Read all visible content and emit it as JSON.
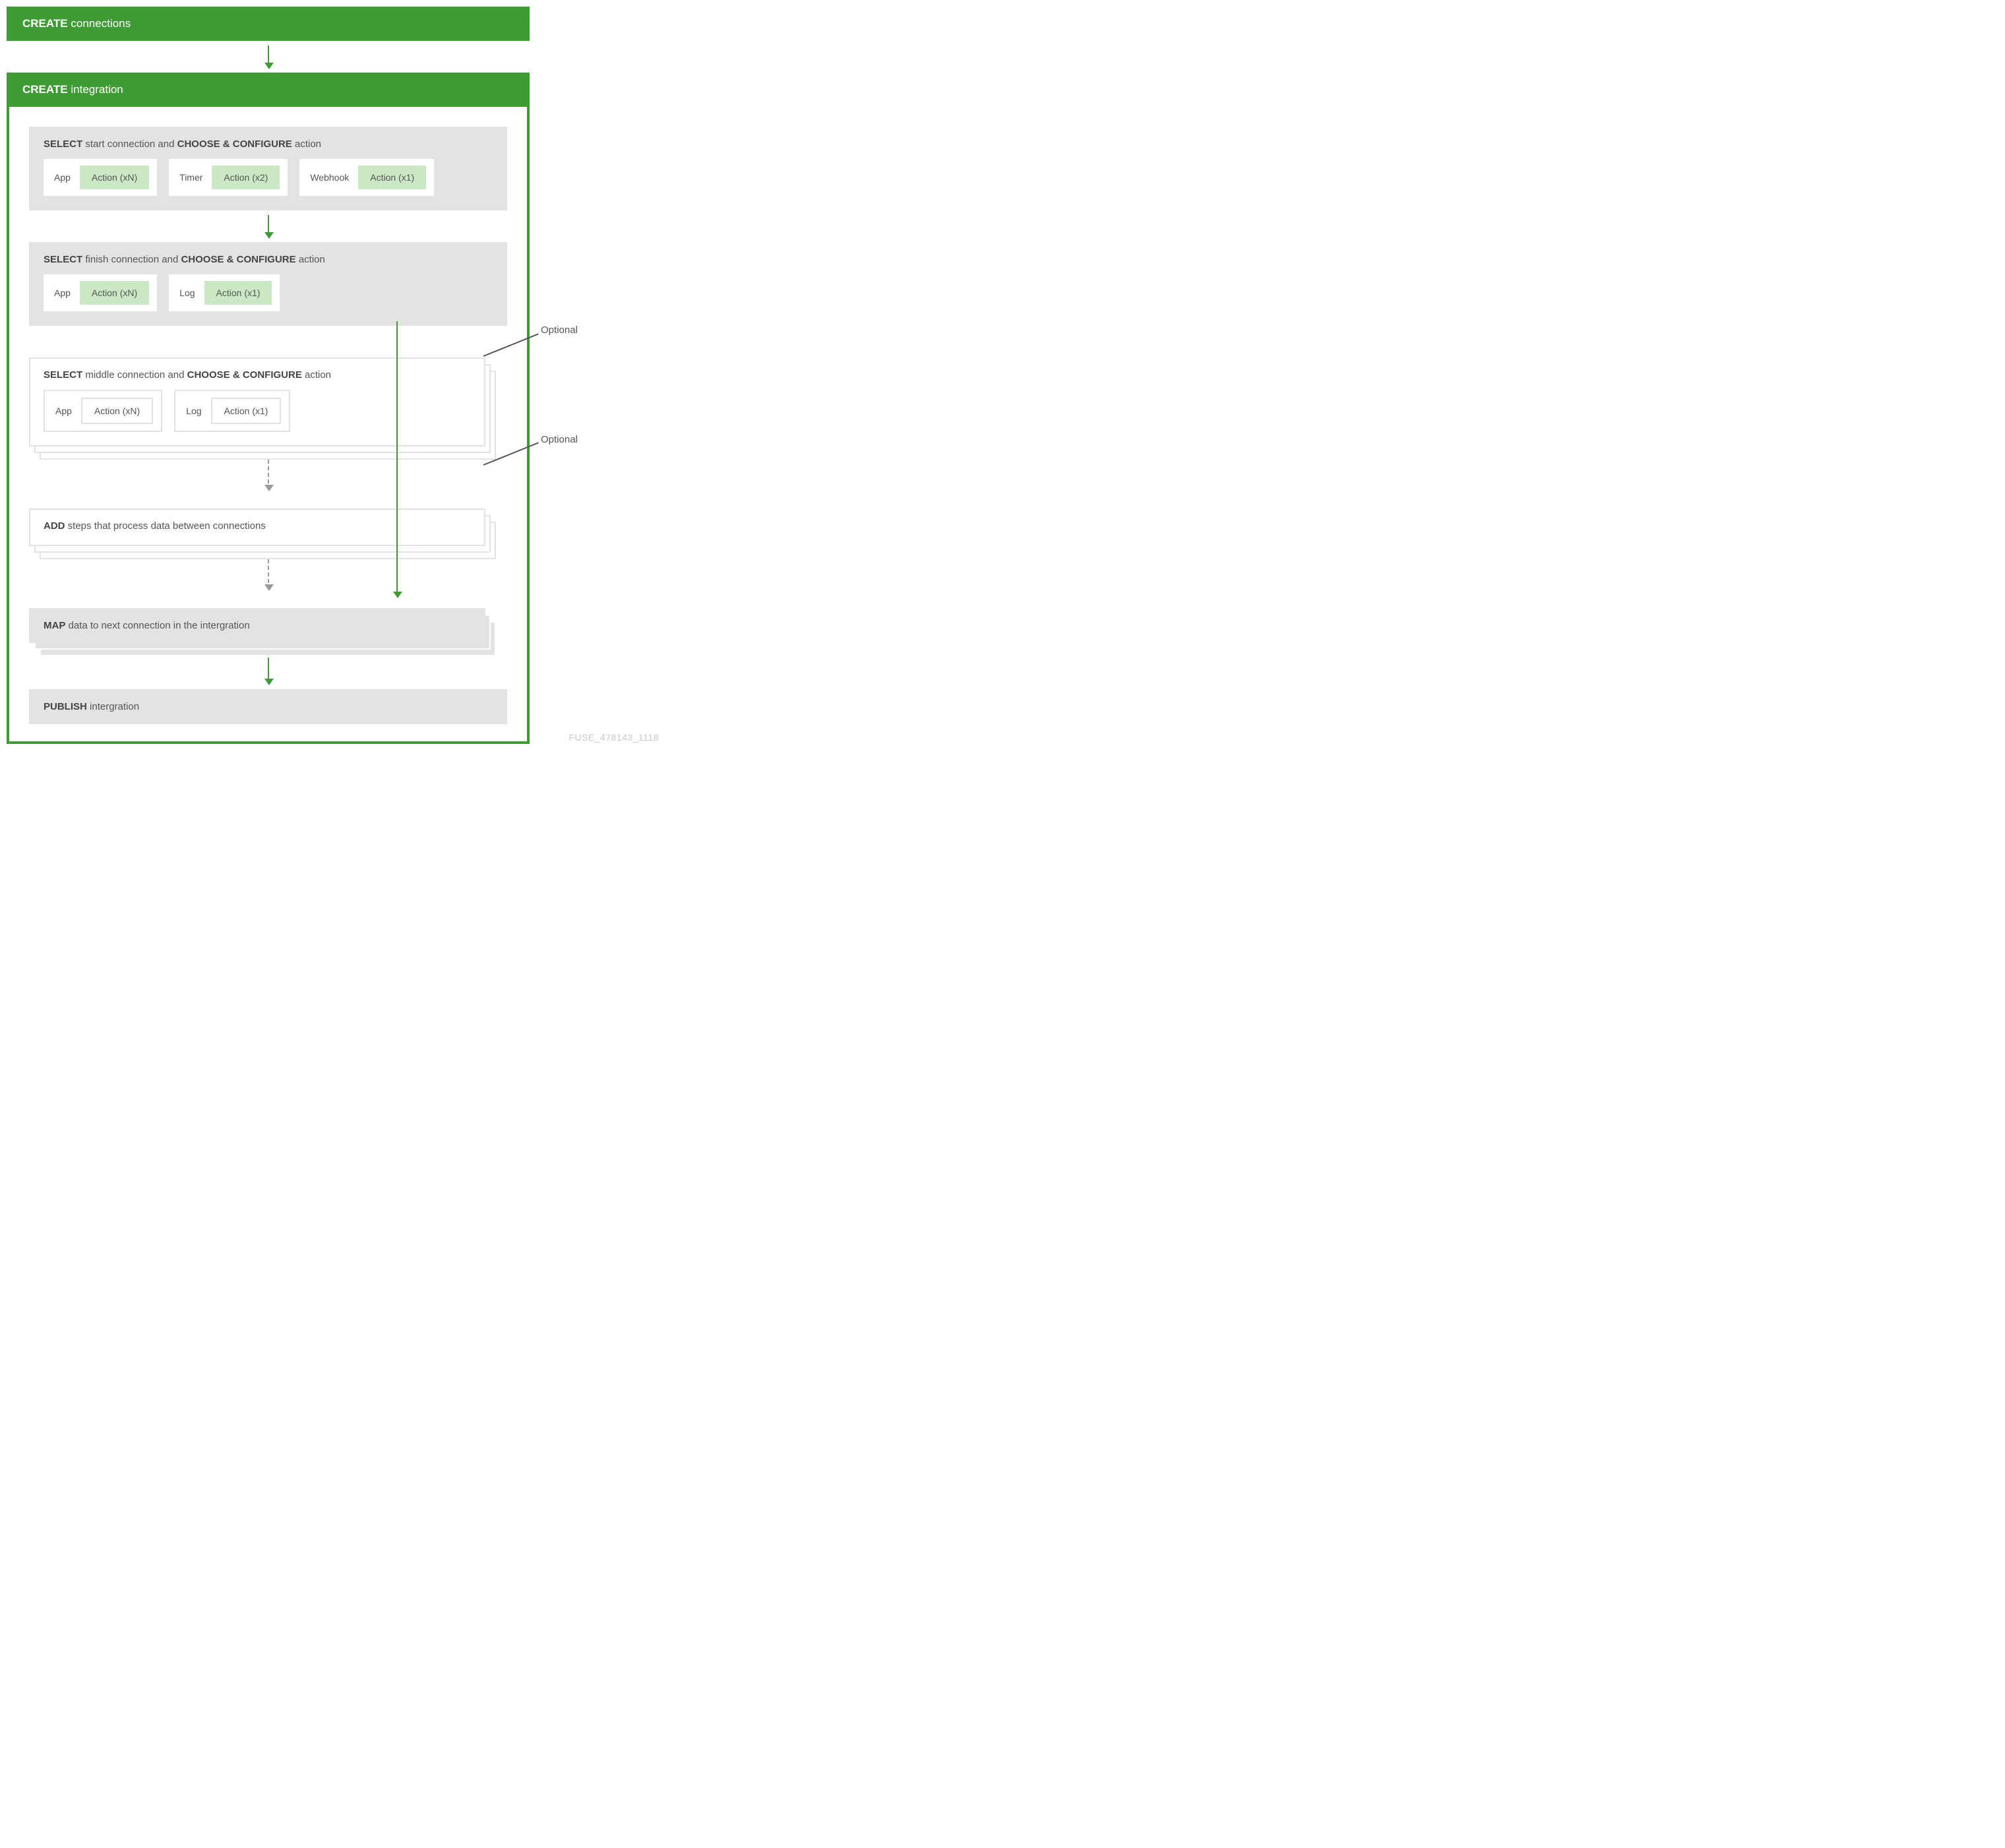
{
  "top_bar": {
    "bold": "CREATE",
    "rest": "connections"
  },
  "integration_bar": {
    "bold": "CREATE",
    "rest": "integration"
  },
  "step_start": {
    "title_bold1": "SELECT",
    "title_mid": "start connection and",
    "title_bold2": "CHOOSE & CONFIGURE",
    "title_end": "action",
    "options": [
      {
        "label": "App",
        "action": "Action (xN)"
      },
      {
        "label": "Timer",
        "action": "Action (x2)"
      },
      {
        "label": "Webhook",
        "action": "Action (x1)"
      }
    ]
  },
  "step_finish": {
    "title_bold1": "SELECT",
    "title_mid": "finish connection and",
    "title_bold2": "CHOOSE & CONFIGURE",
    "title_end": "action",
    "options": [
      {
        "label": "App",
        "action": "Action (xN)"
      },
      {
        "label": "Log",
        "action": "Action (x1)"
      }
    ]
  },
  "step_middle": {
    "title_bold1": "SELECT",
    "title_mid": "middle connection and",
    "title_bold2": "CHOOSE & CONFIGURE",
    "title_end": "action",
    "options": [
      {
        "label": "App",
        "action": "Action (xN)"
      },
      {
        "label": "Log",
        "action": "Action (x1)"
      }
    ]
  },
  "step_add": {
    "bold": "ADD",
    "rest": "steps that process data between connections"
  },
  "step_map": {
    "bold": "MAP",
    "rest": "data to next connection in the intergration"
  },
  "step_publish": {
    "bold": "PUBLISH",
    "rest": "intergration"
  },
  "optional_label": "Optional",
  "footer_id": "FUSE_478143_1118"
}
